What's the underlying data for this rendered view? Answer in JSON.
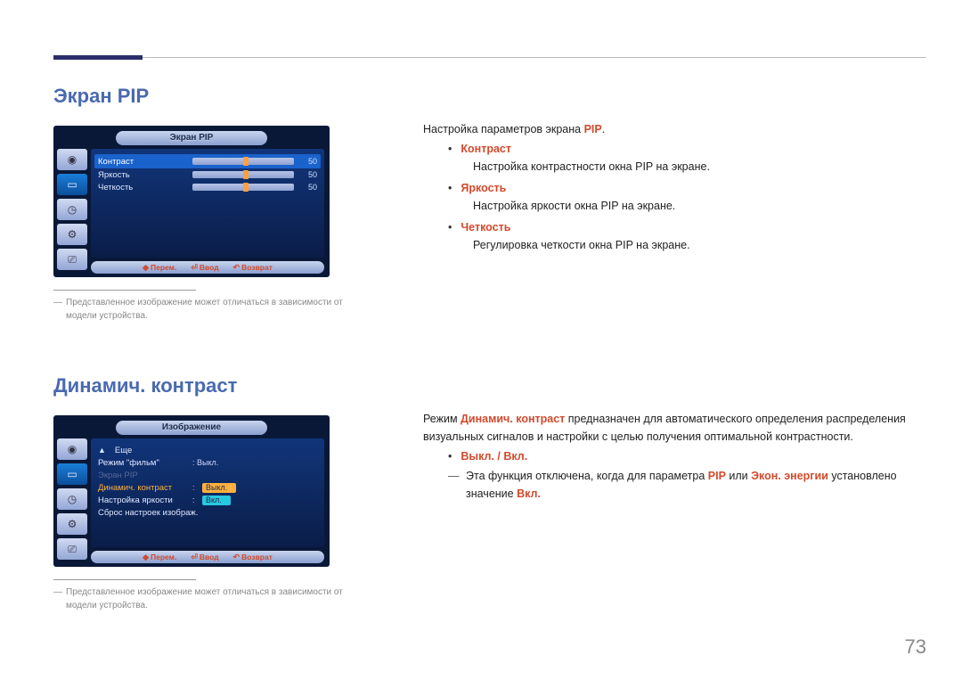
{
  "page_number": "73",
  "section1": {
    "title": "Экран PIP",
    "intro_prefix": "Настройка параметров экрана ",
    "intro_accent": "PIP",
    "intro_suffix": ".",
    "items": [
      {
        "label": "Контраст",
        "desc": "Настройка контрастности окна PIP на экране."
      },
      {
        "label": "Яркость",
        "desc": "Настройка яркости окна PIP на экране."
      },
      {
        "label": "Четкость",
        "desc": "Регулировка четкости окна PIP на экране."
      }
    ],
    "note": "Представленное изображение может отличаться в зависимости от модели устройства.",
    "osd": {
      "title": "Экран PIP",
      "rows": [
        {
          "label": "Контраст",
          "value": "50"
        },
        {
          "label": "Яркость",
          "value": "50"
        },
        {
          "label": "Четкость",
          "value": "50"
        }
      ],
      "footer": {
        "move": "Перем.",
        "enter": "Ввод",
        "return": "Возврат"
      }
    }
  },
  "section2": {
    "title": "Динамич. контраст",
    "body_prefix": "Режим ",
    "body_accent": "Динамич. контраст",
    "body_suffix": " предназначен для автоматического определения распределения визуальных сигналов и настройки с целью получения оптимальной контрастности.",
    "bullet_label": "Выкл. / Вкл.",
    "dash_prefix": "Эта функция отключена, когда для параметра ",
    "dash_a1": "PIP",
    "dash_mid": " или ",
    "dash_a2": "Экон. энергии",
    "dash_mid2": " установлено значение ",
    "dash_a3": "Вкл.",
    "note": "Представленное изображение может отличаться в зависимости от модели устройства.",
    "osd": {
      "title": "Изображение",
      "more": "Еще",
      "rows": {
        "movie": {
          "label": "Режим \"фильм\"",
          "value": "Выкл."
        },
        "pip": {
          "label": "Экран PIP"
        },
        "dyn": {
          "label": "Динамич. контраст",
          "value": "Выкл."
        },
        "bright": {
          "label": "Настройка яркости",
          "value": "Вкл."
        },
        "reset": {
          "label": "Сброс настроек изображ."
        }
      },
      "footer": {
        "move": "Перем.",
        "enter": "Ввод",
        "return": "Возврат"
      }
    }
  }
}
